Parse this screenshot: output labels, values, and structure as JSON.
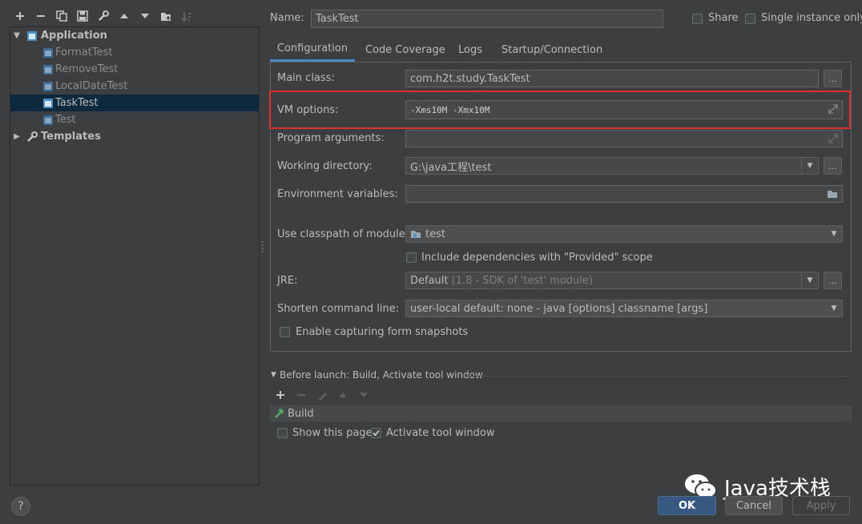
{
  "toolbar": {
    "buttons": [
      "add-icon",
      "remove-icon",
      "copy-icon",
      "save-icon",
      "wrench-icon",
      "move-up-icon",
      "move-down-icon",
      "new-folder-icon",
      "sort-icon"
    ]
  },
  "tree": {
    "application_label": "Application",
    "items": [
      "FormatTest",
      "RemoveTest",
      "LocalDateTest",
      "TaskTest",
      "Test"
    ],
    "templates_label": "Templates"
  },
  "header": {
    "name_label": "Name:",
    "name_value": "TaskTest",
    "share_label": "Share",
    "single_instance_label": "Single instance only"
  },
  "tabs": [
    "Configuration",
    "Code Coverage",
    "Logs",
    "Startup/Connection"
  ],
  "form": {
    "main_class_label": "Main class:",
    "main_class_value": "com.h2t.study.TaskTest",
    "vm_options_label": "VM options:",
    "vm_options_value": "-Xms10M -Xmx10M",
    "program_args_label": "Program arguments:",
    "program_args_value": "",
    "working_dir_label": "Working directory:",
    "working_dir_value": "G:\\java工程\\test",
    "env_vars_label": "Environment variables:",
    "env_vars_value": "",
    "classpath_label": "Use classpath of module:",
    "classpath_value": "test",
    "include_deps_label": "Include dependencies with \"Provided\" scope",
    "jre_label": "JRE:",
    "jre_value": "Default",
    "jre_hint": "(1.8 - SDK of 'test' module)",
    "shorten_label": "Shorten command line:",
    "shorten_value": "user-local default: none - java [options] classname [args]",
    "snapshots_label": "Enable capturing form snapshots",
    "dots": "..."
  },
  "before_launch": {
    "title": "Before launch: Build, Activate tool window",
    "build_item": "Build",
    "show_page_label": "Show this page",
    "activate_label": "Activate tool window"
  },
  "footer": {
    "help": "?",
    "ok": "OK",
    "cancel": "Cancel",
    "apply": "Apply"
  },
  "watermark": "Java技术栈",
  "colors": {
    "background": "#3c3f41",
    "selection": "#0d293e",
    "highlight_box": "#e0302c",
    "ok_button": "#365880"
  }
}
